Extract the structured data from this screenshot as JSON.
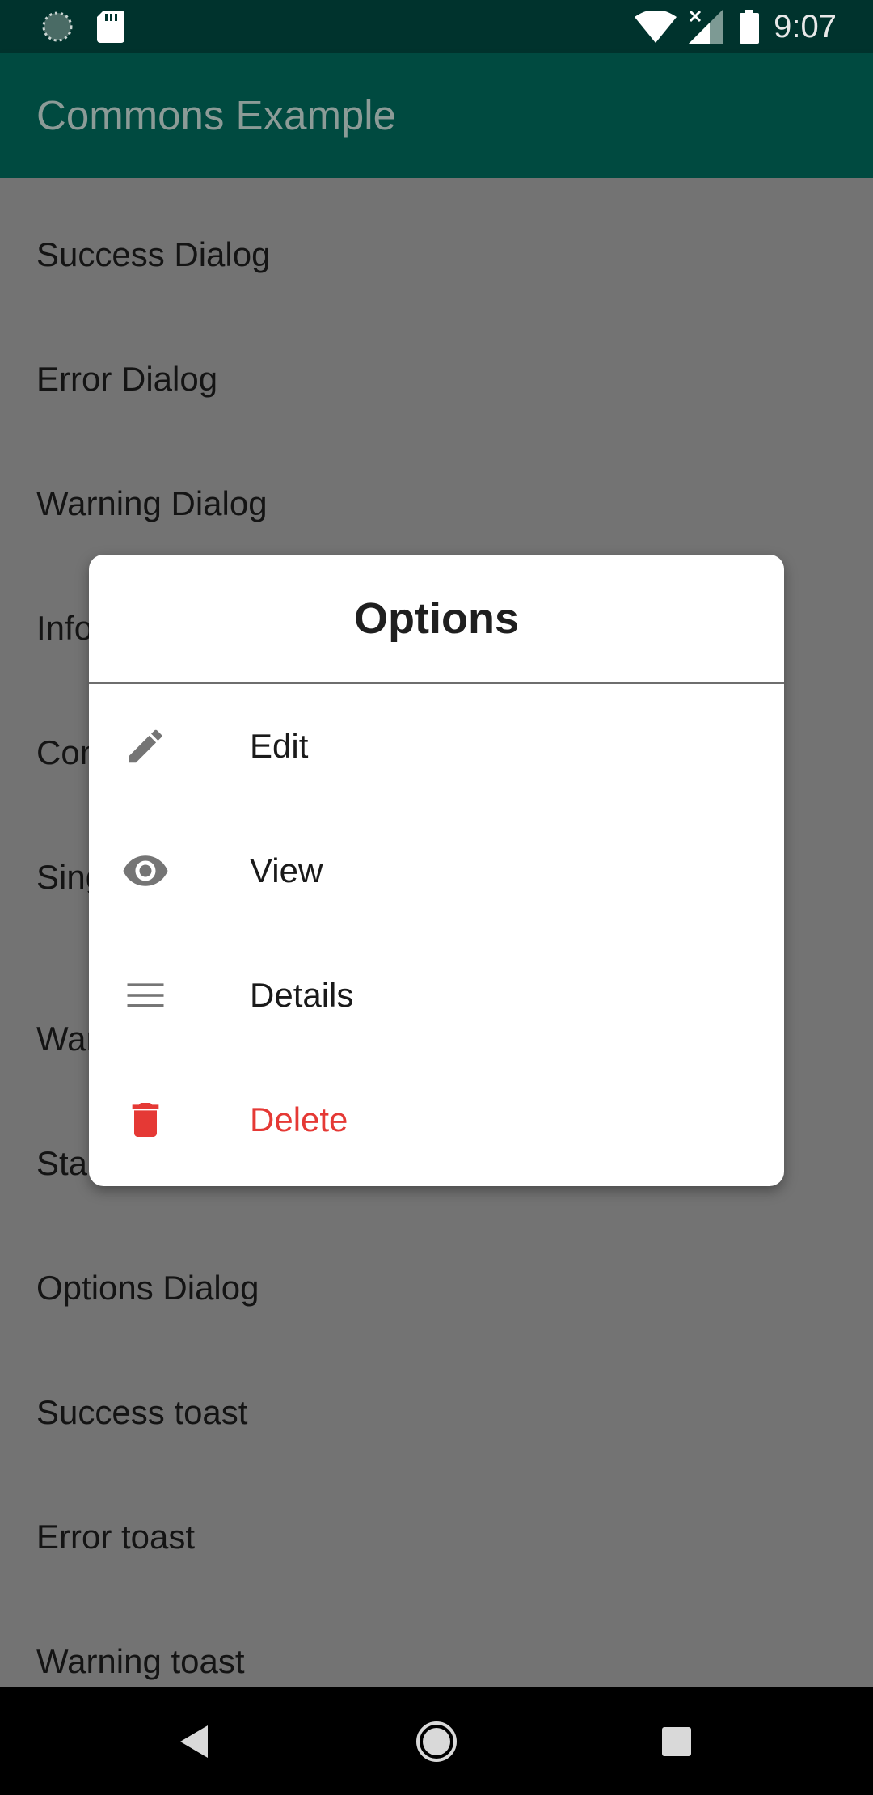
{
  "status_bar": {
    "time": "9:07",
    "icons": [
      "loading-icon",
      "sd-card-icon",
      "wifi-icon",
      "signal-no-data-icon",
      "battery-icon"
    ]
  },
  "app_bar": {
    "title": "Commons Example"
  },
  "list": {
    "items": [
      "Success Dialog",
      "Error Dialog",
      "Warning Dialog",
      "Info Dialog",
      "Confirm Dialog",
      "Single Choice Dialog",
      "Warning Dialog",
      "Standard Dialog",
      "Options Dialog",
      "Success toast",
      "Error toast",
      "Warning toast"
    ]
  },
  "dialog": {
    "title": "Options",
    "options": [
      {
        "label": "Edit",
        "icon": "pencil-icon",
        "color": "#1a1a1a"
      },
      {
        "label": "View",
        "icon": "eye-icon",
        "color": "#1a1a1a"
      },
      {
        "label": "Details",
        "icon": "menu-lines-icon",
        "color": "#1a1a1a"
      },
      {
        "label": "Delete",
        "icon": "trash-icon",
        "color": "#e53935"
      }
    ]
  },
  "colors": {
    "status_bar": "#00332d",
    "app_bar": "#004a40",
    "scrim_list": "#737373",
    "delete": "#e53935",
    "icon_gray": "#757575"
  },
  "nav_bar": {
    "icons": [
      "back-icon",
      "home-icon",
      "recents-icon"
    ]
  }
}
